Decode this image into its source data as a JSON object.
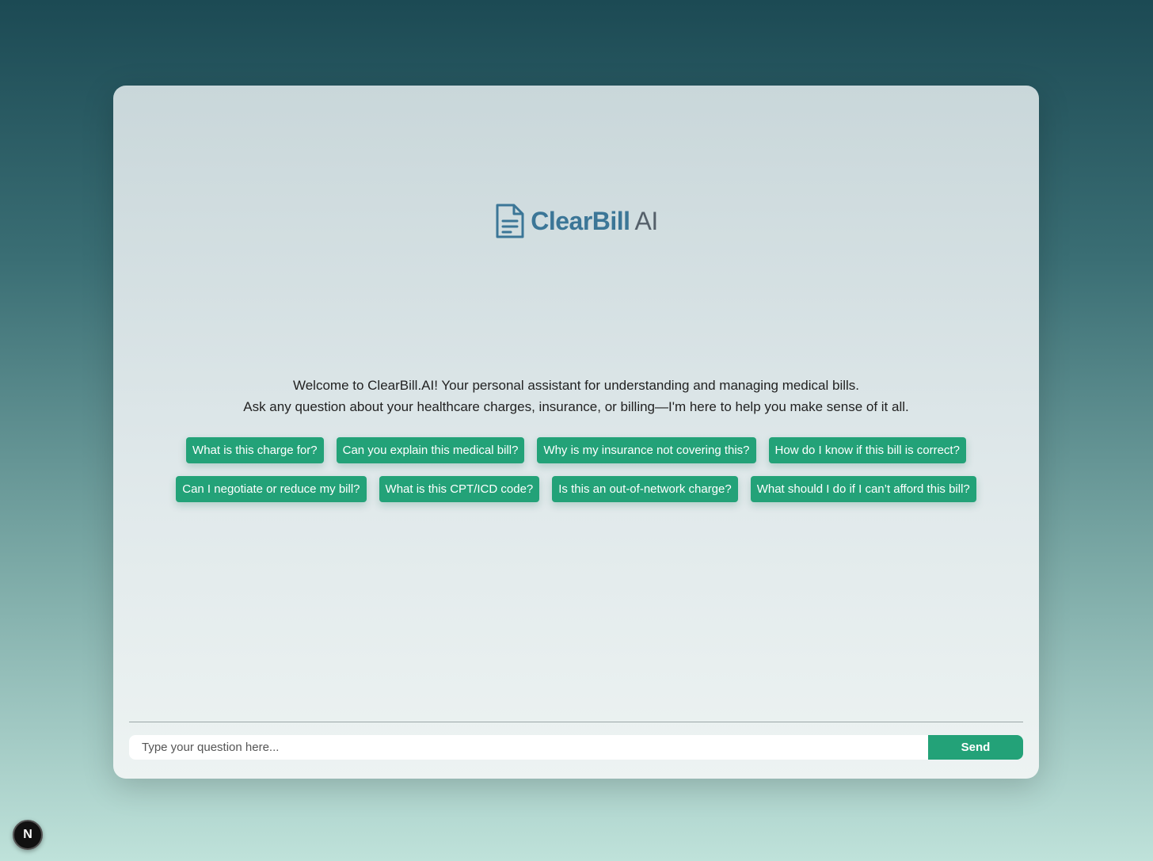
{
  "brand": {
    "name": "ClearBill",
    "suffix": "AI",
    "icon": "document-icon",
    "color": "#3b7697"
  },
  "welcome": {
    "line1": "Welcome to ClearBill.AI! Your personal assistant for understanding and managing medical bills.",
    "line2": "Ask any question about your healthcare charges, insurance, or billing—I'm here to help you make sense of it all."
  },
  "suggestions": {
    "row1": [
      "What is this charge for?",
      "Can you explain this medical bill?",
      "Why is my insurance not covering this?",
      "How do I know if this bill is correct?"
    ],
    "row2": [
      "Can I negotiate or reduce my bill?",
      "What is this CPT/ICD code?",
      "Is this an out-of-network charge?",
      "What should I do if I can’t afford this bill?"
    ]
  },
  "composer": {
    "placeholder": "Type your question here...",
    "send_label": "Send"
  },
  "dev_badge": {
    "label": "N"
  },
  "colors": {
    "accent": "#23a278",
    "brand": "#3b7697"
  }
}
